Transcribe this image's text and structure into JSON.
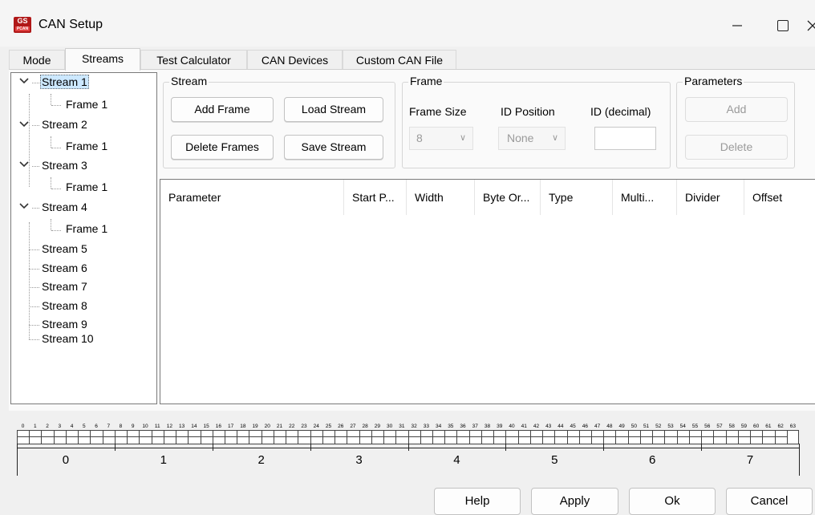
{
  "window": {
    "title": "CAN Setup",
    "icon_text": "GS",
    "icon_subtext": "PCAN"
  },
  "tabs": [
    {
      "label": "Mode"
    },
    {
      "label": "Streams"
    },
    {
      "label": "Test Calculator"
    },
    {
      "label": "CAN Devices"
    },
    {
      "label": "Custom CAN File"
    }
  ],
  "tree": {
    "items": [
      {
        "label": "Stream 1"
      },
      {
        "label": "Frame 1"
      },
      {
        "label": "Stream 2"
      },
      {
        "label": "Frame 1"
      },
      {
        "label": "Stream 3"
      },
      {
        "label": "Frame 1"
      },
      {
        "label": "Stream 4"
      },
      {
        "label": "Frame 1"
      },
      {
        "label": "Stream 5"
      },
      {
        "label": "Stream 6"
      },
      {
        "label": "Stream 7"
      },
      {
        "label": "Stream 8"
      },
      {
        "label": "Stream 9"
      },
      {
        "label": "Stream 10"
      }
    ]
  },
  "stream_group": {
    "label": "Stream",
    "add_frame": "Add Frame",
    "load_stream": "Load Stream",
    "delete_frames": "Delete Frames",
    "save_stream": "Save Stream"
  },
  "frame_group": {
    "label": "Frame",
    "frame_size_label": "Frame Size",
    "frame_size_value": "8",
    "id_position_label": "ID Position",
    "id_position_value": "None",
    "id_decimal_label": "ID (decimal)",
    "id_decimal_value": ""
  },
  "parameters_group": {
    "label": "Parameters",
    "add": "Add",
    "delete": "Delete"
  },
  "table": {
    "columns": [
      "Parameter",
      "Start P...",
      "Width",
      "Byte Or...",
      "Type",
      "Multi...",
      "Divider",
      "Offset"
    ],
    "rows": []
  },
  "ruler": {
    "bit_labels": [
      "0",
      "1",
      "2",
      "3",
      "4",
      "5",
      "6",
      "7",
      "8",
      "9",
      "10",
      "11",
      "12",
      "13",
      "14",
      "15",
      "16",
      "17",
      "18",
      "19",
      "20",
      "21",
      "22",
      "23",
      "24",
      "25",
      "26",
      "27",
      "28",
      "29",
      "30",
      "31",
      "32",
      "33",
      "34",
      "35",
      "36",
      "37",
      "38",
      "39",
      "40",
      "41",
      "42",
      "43",
      "44",
      "45",
      "46",
      "47",
      "48",
      "49",
      "50",
      "51",
      "52",
      "53",
      "54",
      "55",
      "56",
      "57",
      "58",
      "59",
      "60",
      "61",
      "62",
      "63"
    ],
    "byte_labels": [
      "0",
      "1",
      "2",
      "3",
      "4",
      "5",
      "6",
      "7"
    ]
  },
  "footer": {
    "help": "Help",
    "apply": "Apply",
    "ok": "Ok",
    "cancel": "Cancel"
  }
}
